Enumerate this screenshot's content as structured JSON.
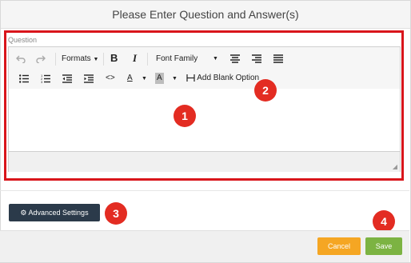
{
  "dialog": {
    "title": "Please Enter Question and Answer(s)"
  },
  "editor": {
    "label": "Question",
    "toolbar": {
      "formats": "Formats",
      "bold": "B",
      "italic": "I",
      "font_family": "Font Family",
      "code": "<>",
      "font_color": "A",
      "bg_color": "A",
      "add_blank_option": "Add Blank Option"
    },
    "content": ""
  },
  "badges": [
    "1",
    "2",
    "3",
    "4"
  ],
  "actions": {
    "advanced_settings": "Advanced Settings",
    "cancel": "Cancel",
    "save": "Save"
  },
  "colors": {
    "highlight": "#d9151b",
    "badge": "#e32c22",
    "advanced_btn": "#2b3a4a",
    "cancel_btn": "#f5a623",
    "save_btn": "#7cb342"
  }
}
